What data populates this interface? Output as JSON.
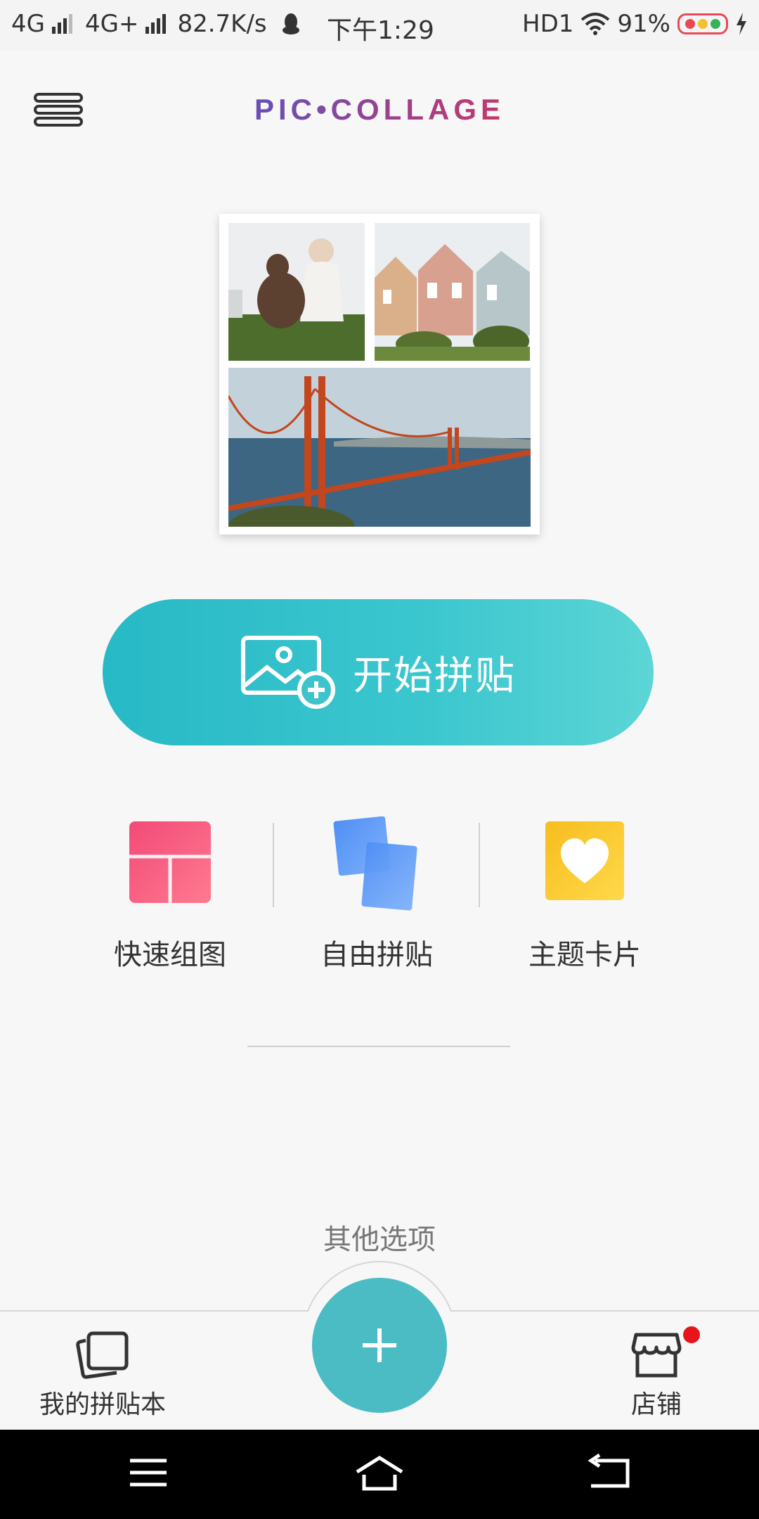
{
  "status_bar": {
    "network1": "4G",
    "network2": "4G+",
    "speed": "82.7K/s",
    "time": "下午1:29",
    "hd": "HD1",
    "battery": "91%",
    "icons": [
      "signal-icon",
      "qq-penguin-icon",
      "wifi-icon",
      "battery-icon",
      "charging-icon"
    ]
  },
  "header": {
    "menu_icon": "menu-icon",
    "logo": "PIC•COLLAGE"
  },
  "preview": {
    "photos": [
      "dog-photo",
      "houses-photo",
      "bridge-photo"
    ]
  },
  "start_button": {
    "label": "开始拼贴",
    "icon": "add-photo-icon"
  },
  "modes": [
    {
      "label": "快速组图",
      "icon": "grid-layout-icon",
      "color": "#f1587f"
    },
    {
      "label": "自由拼贴",
      "icon": "stacked-cards-icon",
      "color": "#5c9cf5"
    },
    {
      "label": "主题卡片",
      "icon": "heart-card-icon",
      "color": "#fbc52c"
    }
  ],
  "other_options": {
    "label": "其他选项"
  },
  "bottom_tabs": {
    "left": {
      "label": "我的拼贴本",
      "icon": "collage-book-icon"
    },
    "fab": {
      "icon": "plus-icon",
      "color": "#4bbcc3"
    },
    "right": {
      "label": "店铺",
      "icon": "store-icon"
    }
  },
  "system_nav": [
    "menu-nav-icon",
    "home-nav-icon",
    "back-nav-icon"
  ]
}
